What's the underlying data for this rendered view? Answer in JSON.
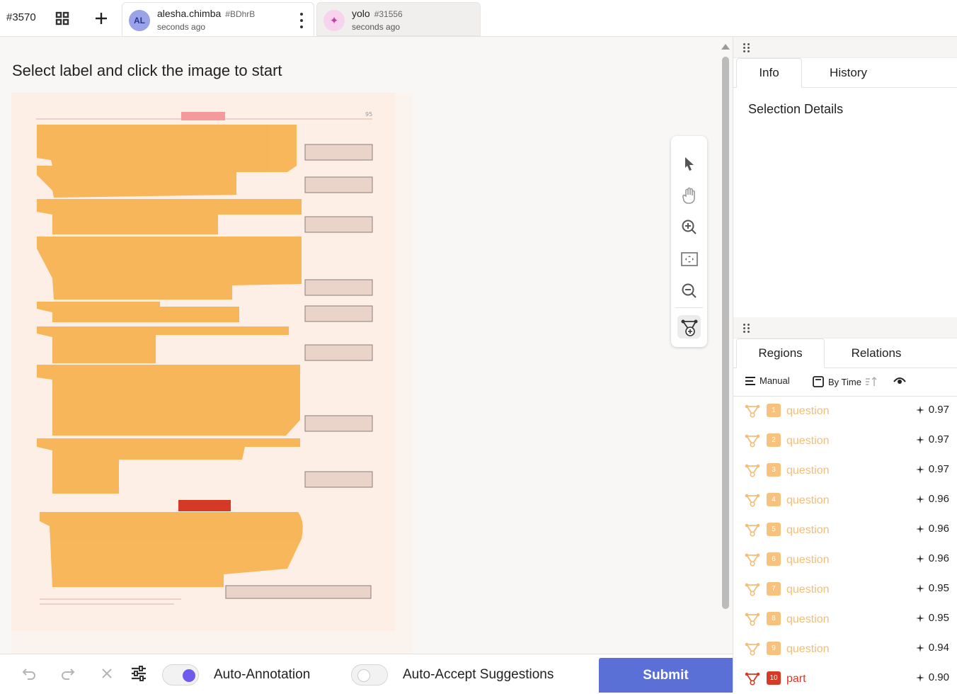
{
  "topbar": {
    "task_id": "#3570",
    "tabs": [
      {
        "avatar": "AL",
        "name": "alesha.chimba",
        "hash": "#BDhrB",
        "time": "seconds ago"
      },
      {
        "avatar": "✦",
        "name": "yolo",
        "hash": "#31556",
        "time": "seconds ago"
      }
    ],
    "icons": [
      "grid-icon",
      "plus-icon",
      "kebab-menu-icon",
      "sparkle-icon"
    ]
  },
  "main": {
    "instruction": "Select label and click the image to start",
    "tools": [
      "pointer-icon",
      "hand-pan-icon",
      "zoom-in-icon",
      "fit-screen-icon",
      "zoom-out-icon",
      "polygon-add-icon"
    ],
    "highlight_color": "#f6b04a",
    "part_color": "#d43a25"
  },
  "bottombar": {
    "auto_annotation_label": "Auto-Annotation",
    "auto_annotation_on": true,
    "auto_accept_label": "Auto-Accept Suggestions",
    "auto_accept_on": false,
    "submit_label": "Submit",
    "submit_color": "#5b70d6"
  },
  "sidebar": {
    "top_tabs": [
      "Info",
      "History"
    ],
    "active_top_tab": "Info",
    "selection_details_title": "Selection Details",
    "bottom_tabs": [
      "Regions",
      "Relations"
    ],
    "active_bottom_tab": "Regions",
    "filters": {
      "manual_label": "Manual",
      "sort_label": "By Time"
    },
    "regions": [
      {
        "num": "1",
        "label": "question",
        "score": "0.97"
      },
      {
        "num": "2",
        "label": "question",
        "score": "0.97"
      },
      {
        "num": "3",
        "label": "question",
        "score": "0.97"
      },
      {
        "num": "4",
        "label": "question",
        "score": "0.96"
      },
      {
        "num": "5",
        "label": "question",
        "score": "0.96"
      },
      {
        "num": "6",
        "label": "question",
        "score": "0.96"
      },
      {
        "num": "7",
        "label": "question",
        "score": "0.95"
      },
      {
        "num": "8",
        "label": "question",
        "score": "0.95"
      },
      {
        "num": "9",
        "label": "question",
        "score": "0.94"
      },
      {
        "num": "10",
        "label": "part",
        "score": "0.90"
      }
    ]
  }
}
